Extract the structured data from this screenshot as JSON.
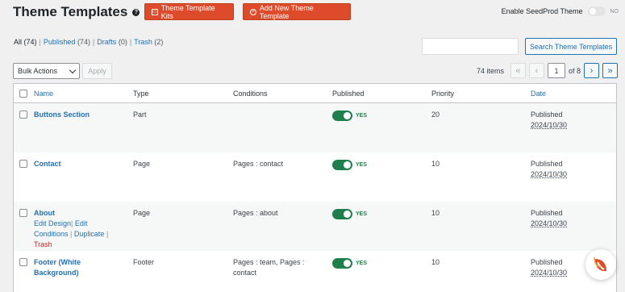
{
  "header": {
    "title": "Theme Templates",
    "help_icon": "?"
  },
  "buttons": {
    "kits_label": "Theme Template Kits",
    "add_label": "Add New Theme Template"
  },
  "seedprod_toggle": {
    "label": "Enable SeedProd Theme",
    "state_label": "NO"
  },
  "filters": {
    "all_label": "All",
    "all_count": "(74)",
    "published_label": "Published",
    "published_count": "(74)",
    "drafts_label": "Drafts",
    "drafts_count": "(0)",
    "trash_label": "Trash",
    "trash_count": "(2)",
    "sep": "|"
  },
  "search": {
    "button_label": "Search Theme Templates",
    "value": ""
  },
  "bulk": {
    "selected": "Bulk Actions",
    "apply_label": "Apply"
  },
  "pagination": {
    "items": "74 items",
    "first": "«",
    "prev": "‹",
    "current_page": "1",
    "of_label": "of 8",
    "next": "›",
    "last": "»"
  },
  "columns": {
    "name": "Name",
    "type": "Type",
    "conditions": "Conditions",
    "published": "Published",
    "priority": "Priority",
    "date": "Date"
  },
  "rows": [
    {
      "name": "Buttons Section",
      "type": "Part",
      "conditions": "",
      "published": "YES",
      "priority": "20",
      "status": "Published",
      "date": "2024/10/30"
    },
    {
      "name": "Contact",
      "type": "Page",
      "conditions": "Pages : contact",
      "published": "YES",
      "priority": "10",
      "status": "Published",
      "date": "2024/10/30"
    },
    {
      "name": "About",
      "type": "Page",
      "conditions": "Pages : about",
      "published": "YES",
      "priority": "10",
      "status": "Published",
      "date": "2024/10/30",
      "actions": {
        "edit_design": "Edit Design",
        "edit_conditions_1": "Edit",
        "edit_conditions_2": "Conditions",
        "duplicate": "Duplicate",
        "trash": "Trash",
        "pipe": "|"
      }
    },
    {
      "name_line1": "Footer (White",
      "name_line2": "Background)",
      "type": "Footer",
      "conditions_line1": "Pages : team, Pages :",
      "conditions_line2": "contact",
      "published": "YES",
      "priority": "10",
      "status": "Published",
      "date": "2024/10/30"
    }
  ],
  "colors": {
    "accent_red": "#dd4b2b",
    "link_blue": "#2271b1",
    "toggle_green": "#1e7e4c"
  }
}
